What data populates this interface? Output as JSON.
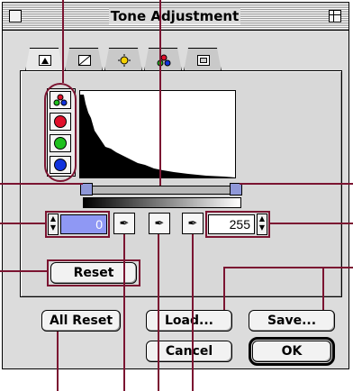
{
  "window": {
    "title": "Tone Adjustment"
  },
  "tabs": [
    {
      "name": "tab-tone-curve",
      "icon": "triangle-icon"
    },
    {
      "name": "tab-levels",
      "icon": "square-curve-icon"
    },
    {
      "name": "tab-brightness",
      "icon": "sun-icon"
    },
    {
      "name": "tab-color-balance",
      "icon": "rgb-dots-icon"
    },
    {
      "name": "tab-preview",
      "icon": "frame-icon"
    }
  ],
  "channels": [
    {
      "name": "rgb",
      "color": "#777777"
    },
    {
      "name": "red",
      "color": "#e0102b"
    },
    {
      "name": "green",
      "color": "#1ec01e"
    },
    {
      "name": "blue",
      "color": "#1133dd"
    }
  ],
  "levels": {
    "input_min": "0",
    "input_max": "255"
  },
  "buttons": {
    "reset": "Reset",
    "all_reset": "All Reset",
    "load": "Load...",
    "save": "Save...",
    "cancel": "Cancel",
    "ok": "OK"
  },
  "colors": {
    "callout_lines": "#7b1431",
    "selected_field": "#8f98f4",
    "slider_thumb": "#8f98d8"
  }
}
